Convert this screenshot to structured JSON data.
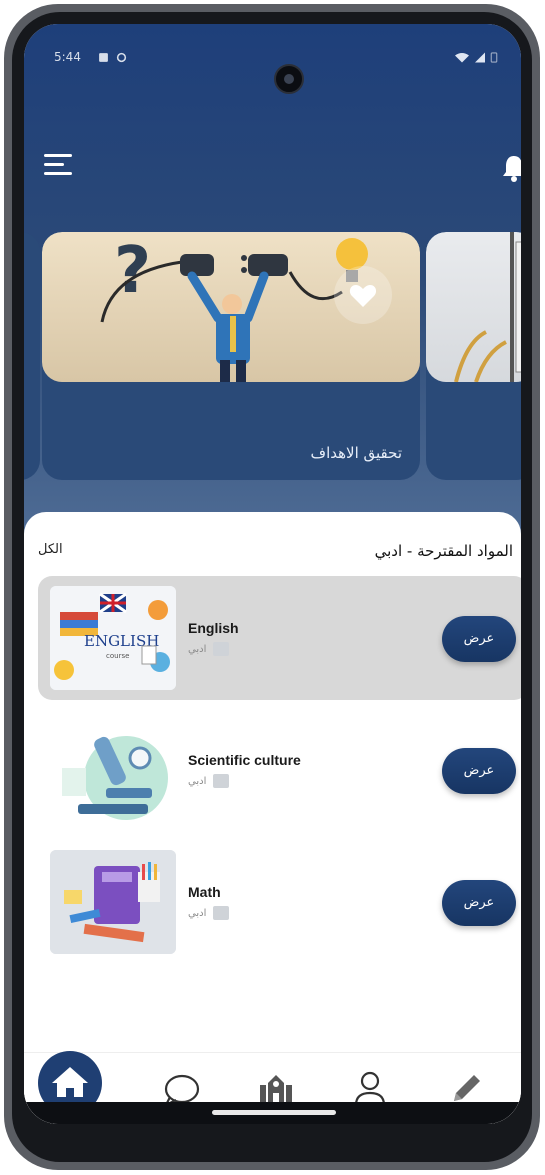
{
  "status_bar": {
    "time": "5:44"
  },
  "header": {},
  "carousel": {
    "cards": [
      {
        "title": "تحقيق الاهداف"
      }
    ]
  },
  "section": {
    "title": "المواد المقترحة - ادبي",
    "see_all": "الكل"
  },
  "subjects": [
    {
      "name": "English",
      "branch": "ادبي",
      "action": "عرض",
      "selected": true
    },
    {
      "name": "Scientific culture",
      "branch": "ادبي",
      "action": "عرض",
      "selected": false
    },
    {
      "name": "Math",
      "branch": "ادبي",
      "action": "عرض",
      "selected": false
    }
  ],
  "thumb_text": {
    "english": "ENGLISH",
    "course": "course"
  },
  "bottom_nav": {
    "items": [
      "home-icon",
      "chat-icon",
      "school-icon",
      "profile-icon",
      "pencil-icon"
    ],
    "active": "home-icon"
  },
  "colors": {
    "primary": "#1f3f73",
    "hero": "#2c4a77",
    "selected_row": "#d8d8d8"
  }
}
